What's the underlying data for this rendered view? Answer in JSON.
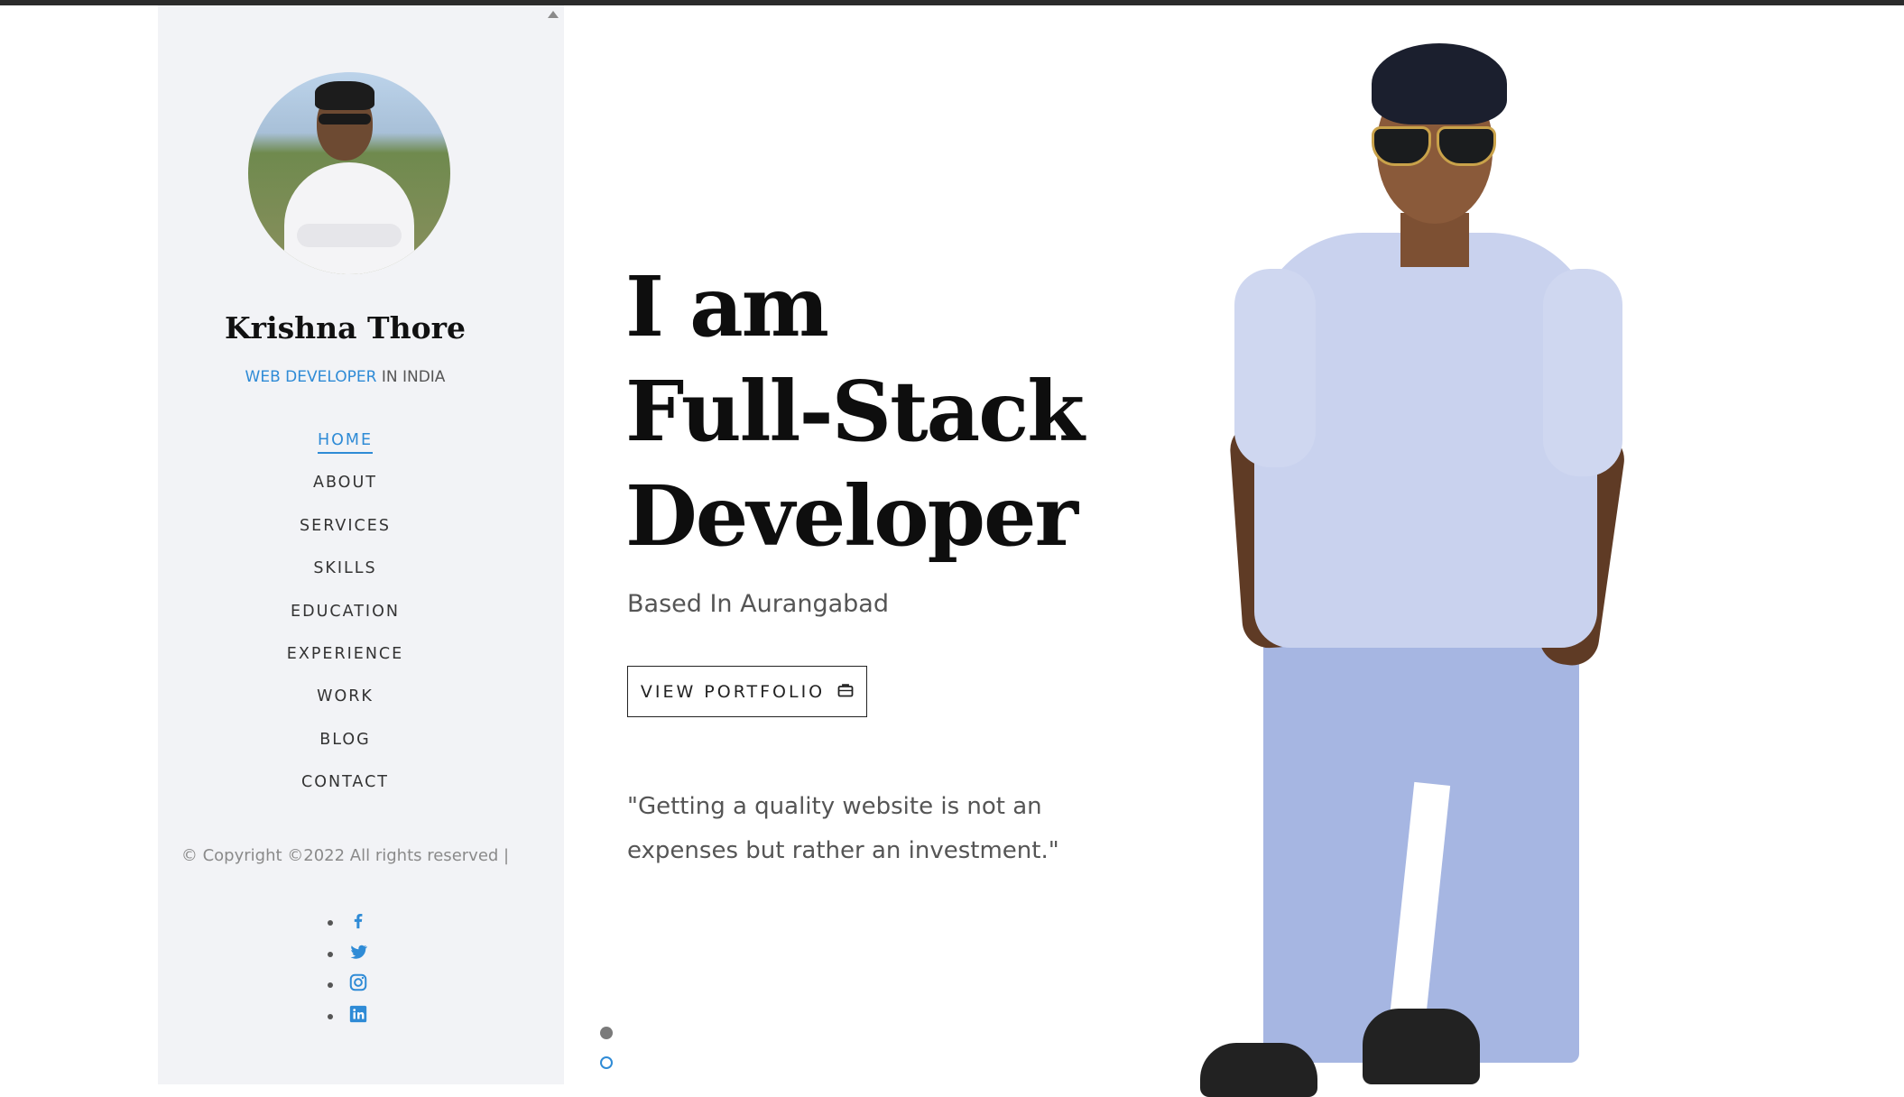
{
  "sidebar": {
    "name": "Krishna Thore",
    "role_accent": "WEB DEVELOPER",
    "role_rest": " IN INDIA",
    "nav": [
      {
        "label": "HOME"
      },
      {
        "label": "ABOUT"
      },
      {
        "label": "SERVICES"
      },
      {
        "label": "SKILLS"
      },
      {
        "label": "EDUCATION"
      },
      {
        "label": "EXPERIENCE"
      },
      {
        "label": "WORK"
      },
      {
        "label": "BLOG"
      },
      {
        "label": "CONTACT"
      }
    ],
    "active_nav": "HOME",
    "copyright": "© Copyright ©2022 All rights reserved |",
    "social": [
      "facebook-icon",
      "twitter-icon",
      "instagram-icon",
      "linkedin-icon"
    ]
  },
  "hero": {
    "headline": [
      "I am",
      "Full-Stack",
      "Developer"
    ],
    "based": "Based In Aurangabad",
    "button_label": "VIEW PORTFOLIO",
    "button_icon": "briefcase-icon",
    "quote": "\"Getting a quality website is not an expenses but rather an investment.\""
  },
  "colors": {
    "accent": "#2f8bd6",
    "sidebar_bg": "#f2f3f6",
    "text_dark": "#0e0e0e",
    "text_muted": "#555555"
  }
}
